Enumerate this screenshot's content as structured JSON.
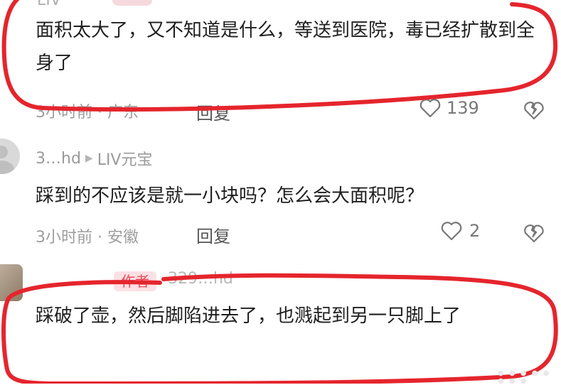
{
  "comments": [
    {
      "username": "LIV",
      "text": "面积太大了，又不知道是什么，等送到医院，毒已经扩散到全身了",
      "meta": "3小时前 · 广东",
      "reply_label": "回复",
      "likes": "139"
    },
    {
      "username": "3…hd",
      "username_suffix": "LIV元宝",
      "text": "踩到的不应该是就一小块吗？怎么会大面积呢？",
      "meta": "3小时前 · 安徽",
      "reply_label": "回复",
      "likes": "2"
    },
    {
      "badge": "作者",
      "reply_to": "329…hd",
      "text": "踩破了壶，然后脚陷进去了，也溅起到另一只脚上了"
    }
  ],
  "colors": {
    "scribble": "#e5252d",
    "author_badge_bg": "#fde0e4",
    "author_badge_text": "#e94a5a"
  },
  "icons": {
    "like": "heart-outline-icon",
    "dislike": "broken-heart-icon",
    "arrow": "play-arrow-icon"
  }
}
